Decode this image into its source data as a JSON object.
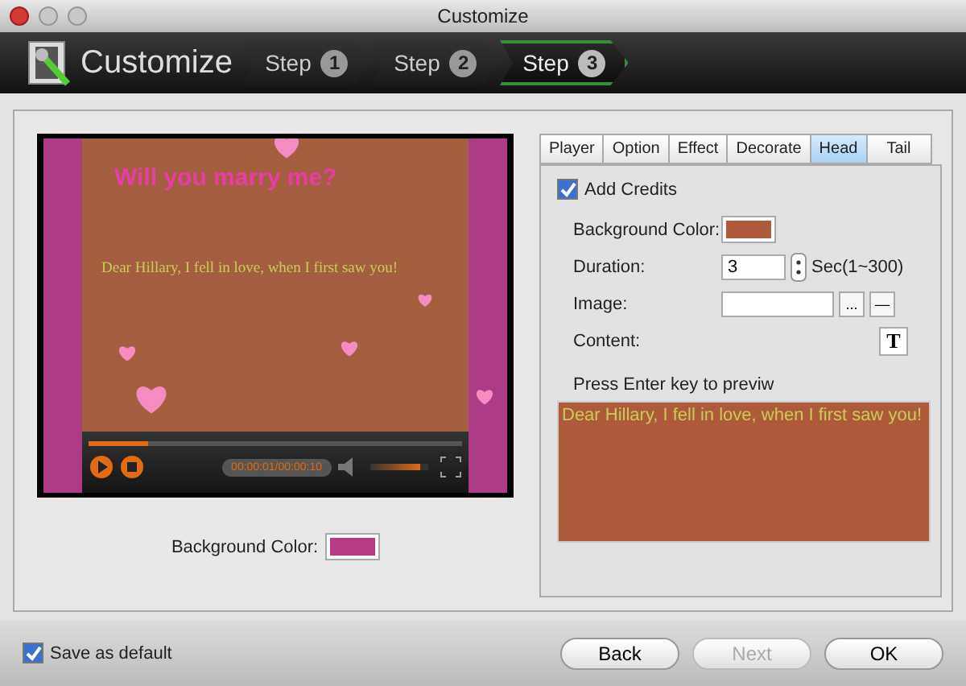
{
  "window": {
    "title": "Customize"
  },
  "header": {
    "title": "Customize",
    "steps": [
      {
        "label": "Step",
        "number": "1",
        "selected": false
      },
      {
        "label": "Step",
        "number": "2",
        "selected": false
      },
      {
        "label": "Step",
        "number": "3",
        "selected": true
      }
    ]
  },
  "preview": {
    "heading": "Will you marry me?",
    "message": "Dear Hillary, I fell in love, when I first saw you!",
    "seek": {
      "level": 0.16
    },
    "time": "00:00:01/00:00:10",
    "volume": {
      "level": 0.85
    }
  },
  "background_color": {
    "label": "Background Color:",
    "color": "#b83a86"
  },
  "tabs": [
    {
      "label": "Player",
      "selected": false
    },
    {
      "label": "Option",
      "selected": false
    },
    {
      "label": "Effect",
      "selected": false
    },
    {
      "label": "Decorate",
      "selected": false
    },
    {
      "label": "Head",
      "selected": true
    },
    {
      "label": "Tail",
      "selected": false
    }
  ],
  "head": {
    "add_credits": {
      "label": "Add Credits",
      "checked": true
    },
    "background_color": {
      "label": "Background Color:",
      "color": "#b05a3c"
    },
    "duration": {
      "label": "Duration:",
      "value": "3",
      "unit": "Sec(1~300)"
    },
    "image": {
      "label": "Image:",
      "browse": "...",
      "remove": "—"
    },
    "content": {
      "label": "Content:",
      "button": "T"
    },
    "hint": "Press Enter key to previw",
    "text": "Dear Hillary, I fell in love, when I first saw you!"
  },
  "footer": {
    "save_default": {
      "label": "Save as default",
      "checked": true
    },
    "buttons": [
      {
        "label": "Back",
        "disabled": false
      },
      {
        "label": "Next",
        "disabled": true
      },
      {
        "label": "OK",
        "disabled": false
      }
    ]
  }
}
